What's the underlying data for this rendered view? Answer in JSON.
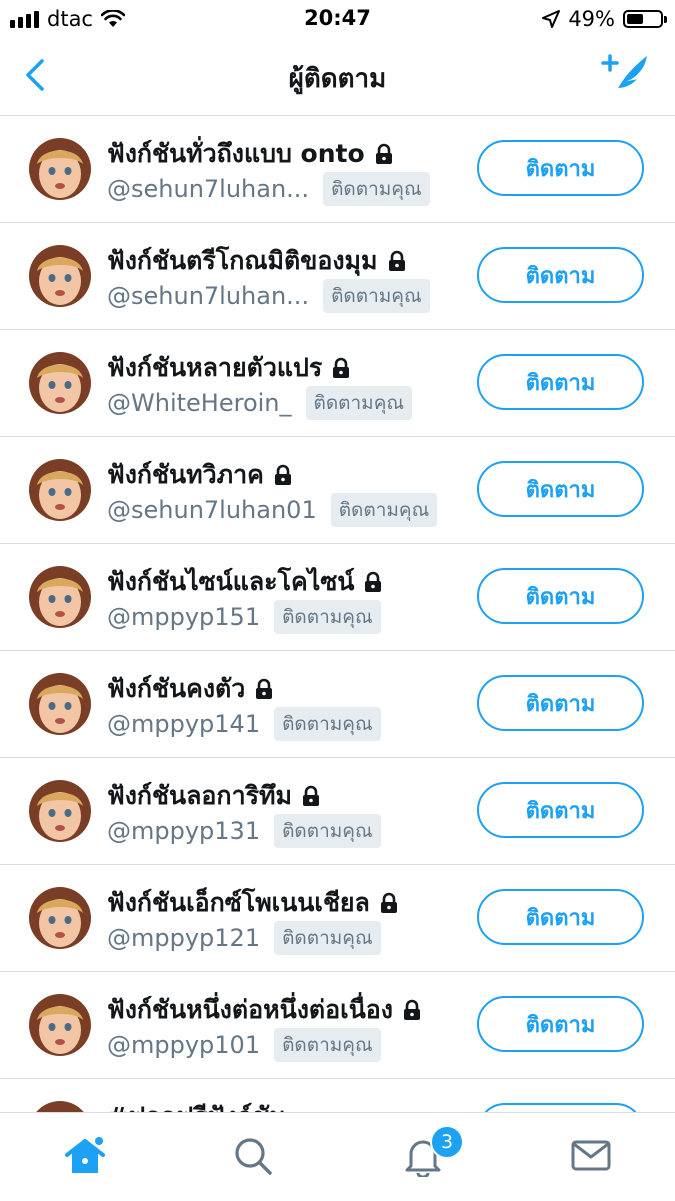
{
  "status_bar": {
    "carrier": "dtac",
    "time": "20:47",
    "battery": "49%",
    "battery_level": 0.49,
    "icons": [
      "signal-icon",
      "wifi-icon",
      "location-arrow-icon",
      "battery-icon"
    ]
  },
  "header": {
    "title": "ผู้ติดตาม",
    "back_icon": "chevron-left-icon",
    "compose_icon": "compose-tweet-icon"
  },
  "accent_color": "#1da1f2",
  "followers": [
    {
      "name": "ฟังก์ชันทั่วถึงแบบ onto",
      "handle": "@sehun7luhan...",
      "badge": "ติดตามคุณ",
      "follow_label": "ติดตาม"
    },
    {
      "name": "ฟังก์ชันตรีโกณมิติของมุม",
      "handle": "@sehun7luhan...",
      "badge": "ติดตามคุณ",
      "follow_label": "ติดตาม"
    },
    {
      "name": "ฟังก์ชันหลายตัวแปร",
      "handle": "@WhiteHeroin_",
      "badge": "ติดตามคุณ",
      "follow_label": "ติดตาม"
    },
    {
      "name": "ฟังก์ชันทวิภาค",
      "handle": "@sehun7luhan01",
      "badge": "ติดตามคุณ",
      "follow_label": "ติดตาม"
    },
    {
      "name": "ฟังก์ชันไซน์และโคไซน์",
      "handle": "@mppyp151",
      "badge": "ติดตามคุณ",
      "follow_label": "ติดตาม"
    },
    {
      "name": "ฟังก์ชันคงตัว",
      "handle": "@mppyp141",
      "badge": "ติดตามคุณ",
      "follow_label": "ติดตาม"
    },
    {
      "name": "ฟังก์ชันลอการิทึม",
      "handle": "@mppyp131",
      "badge": "ติดตามคุณ",
      "follow_label": "ติดตาม"
    },
    {
      "name": "ฟังก์ชันเอ็กซ์โพเนนเชียล",
      "handle": "@mppyp121",
      "badge": "ติดตามคุณ",
      "follow_label": "ติดตาม"
    },
    {
      "name": "ฟังก์ชันหนึ่งต่อหนึ่งต่อเนื่อง",
      "handle": "@mppyp101",
      "badge": "ติดตามคุณ",
      "follow_label": "ติดตาม"
    },
    {
      "name": "#ฟอลฟรีฟังก์ชัน",
      "handle": "",
      "badge": "",
      "follow_label": ""
    }
  ],
  "tab_bar": {
    "tabs": [
      "home-icon",
      "search-icon",
      "notifications-icon",
      "messages-icon"
    ],
    "notification_count": "3"
  }
}
